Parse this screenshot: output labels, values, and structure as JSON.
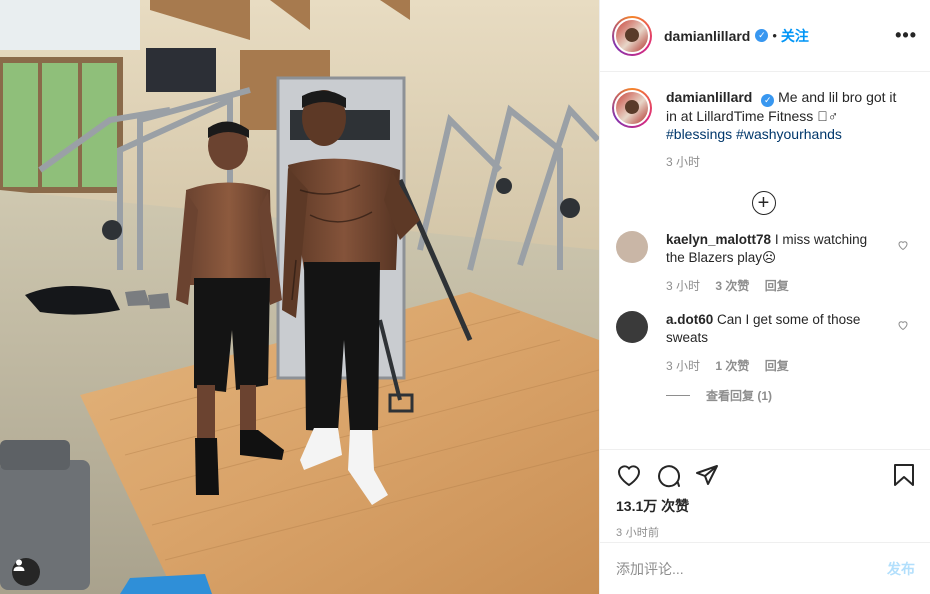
{
  "post": {
    "username": "damianlillard",
    "follow_label": "关注",
    "more_label": "•••",
    "caption": {
      "username": "damianlillard",
      "text": "Me and lil bro got it in at LillardTime Fitness 🏽‍♂",
      "hashtags": [
        "#blessings",
        "#washyourhands"
      ],
      "time": "3 小时"
    },
    "load_more_label": "+"
  },
  "comments": [
    {
      "username": "kaelyn_malott78",
      "text": "I miss watching the Blazers play☹",
      "time": "3 小时",
      "likes": "3 次赞",
      "reply": "回复",
      "avatar_color": "#c9b6a6"
    },
    {
      "username": "a.dot60",
      "text": "Can I get some of those sweats",
      "time": "3 小时",
      "likes": "1 次赞",
      "reply": "回复",
      "avatar_color": "#3a3a3a"
    }
  ],
  "view_replies": "查看回复 (1)",
  "actions": {
    "icons": [
      "heart-icon",
      "comment-icon",
      "share-icon",
      "bookmark-icon"
    ],
    "likes": "13.1万 次赞",
    "posted": "3 小时前"
  },
  "add_comment": {
    "placeholder": "添加评论...",
    "post_label": "发布"
  },
  "colors": {
    "accent": "#0095f6",
    "verified": "#3897f0",
    "post_disabled": "#b2dffc"
  }
}
